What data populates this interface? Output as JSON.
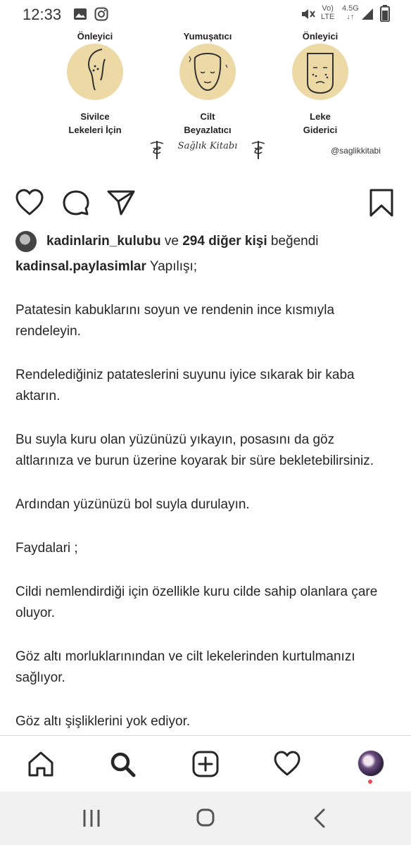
{
  "status_bar": {
    "time": "12:33",
    "network_top": "Vo)",
    "network_bottom": "LTE",
    "signal_top": "4.5G",
    "signal_bottom": "↓↑"
  },
  "post_image": {
    "features": [
      {
        "top": "Önleyici",
        "bottom_line1": "Sivilce",
        "bottom_line2": "Lekeleri İçin"
      },
      {
        "top": "Yumuşatıcı",
        "bottom_line1": "Cilt",
        "bottom_line2": "Beyazlatıcı"
      },
      {
        "top": "Önleyici",
        "bottom_line1": "Leke",
        "bottom_line2": "Giderici"
      }
    ],
    "brand": "Sağlık Kitabı",
    "handle": "@saglikkitabi",
    "accent_color": "#ecd9a6"
  },
  "likes": {
    "user": "kadinlarin_kulubu",
    "connector": " ve ",
    "count_text": "294 diğer kişi",
    "suffix": " beğendi"
  },
  "caption": {
    "author": "kadinsal.paylasimlar",
    "title": " Yapılışı;",
    "paragraphs": [
      "Patatesin kabuklarını soyun ve rendenin ince kısmıyla rendeleyin.",
      "Rendelediğiniz patateslerini suyunu iyice sıkarak bir kaba aktarın.",
      "Bu suyla kuru olan yüzünüzü yıkayın, posasını da göz altlarınıza ve burun üzerine koyarak bir süre bekletebilirsiniz.",
      "Ardından yüzünüzü bol suyla durulayın.",
      "Faydalari ;",
      "Cildi nemlendirdiği için özellikle kuru cilde sahip olanlara çare oluyor.",
      "Göz altı morluklarınından ve cilt lekelerinden kurtulmanızı sağlıyor.",
      "Göz altı şişliklerini yok ediyor."
    ]
  },
  "colors": {
    "notification_dot": "#ed4956",
    "text": "#262626"
  },
  "icons": {
    "actions": [
      "heart-icon",
      "comment-icon",
      "share-icon",
      "bookmark-icon"
    ],
    "bottom_nav": [
      "home-icon",
      "search-icon",
      "add-icon",
      "activity-heart-icon",
      "profile-avatar"
    ],
    "system_nav": [
      "recents-icon",
      "home-circle-icon",
      "back-icon"
    ]
  }
}
